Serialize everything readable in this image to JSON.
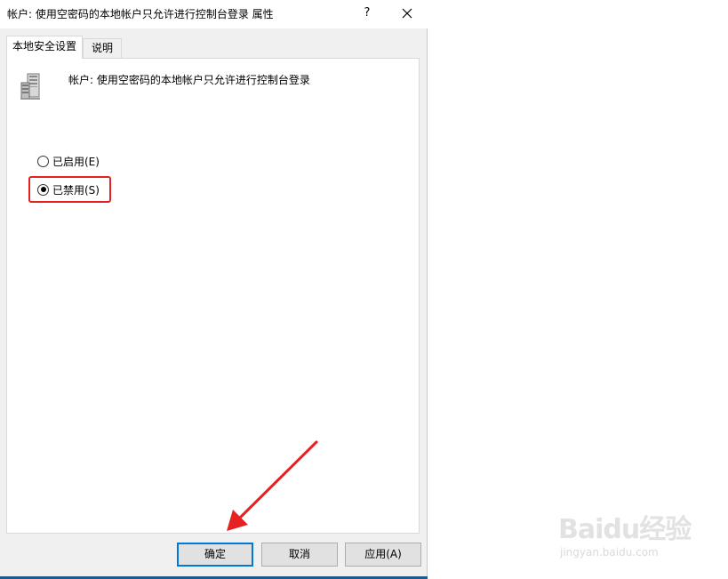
{
  "window": {
    "title": "帐户: 使用空密码的本地帐户只允许进行控制台登录 属性",
    "help_label": "?",
    "close_icon": "close-icon"
  },
  "tabs": [
    {
      "label": "本地安全设置",
      "active": true
    },
    {
      "label": "说明",
      "active": false
    }
  ],
  "policy": {
    "icon": "server-icon",
    "name": "帐户: 使用空密码的本地帐户只允许进行控制台登录"
  },
  "options": [
    {
      "label": "已启用(E)",
      "checked": false
    },
    {
      "label": "已禁用(S)",
      "checked": true
    }
  ],
  "buttons": {
    "ok": "确定",
    "cancel": "取消",
    "apply": "应用(A)"
  },
  "annotation": {
    "highlight_color": "#e52121",
    "arrow_color": "#e52121"
  },
  "watermark": {
    "logo": "Baidu经验",
    "url": "jingyan.baidu.com"
  }
}
